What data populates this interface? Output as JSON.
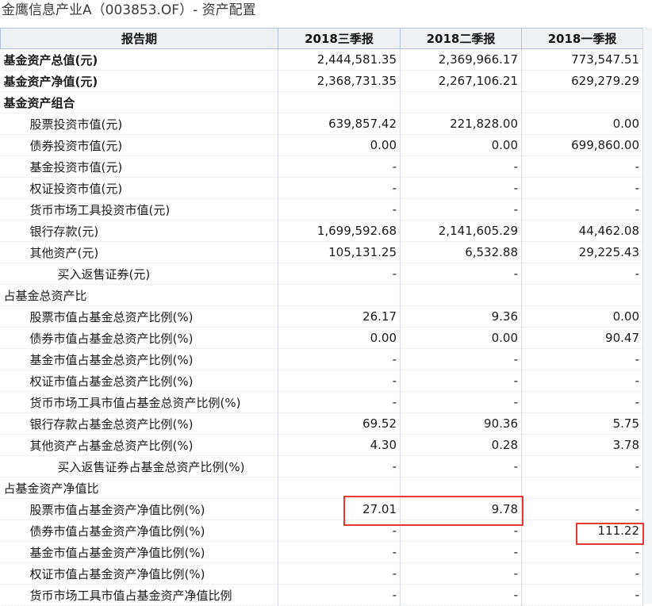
{
  "title": "金鹰信息产业A（003853.OF）- 资产配置",
  "columns": [
    "报告期",
    "2018三季报",
    "2018二季报",
    "2018一季报"
  ],
  "rows": [
    {
      "label": "基金资产总值(元)",
      "level": 0,
      "bold": true,
      "values": [
        "2,444,581.35",
        "2,369,966.17",
        "773,547.51"
      ]
    },
    {
      "label": "基金资产净值(元)",
      "level": 0,
      "bold": true,
      "values": [
        "2,368,731.35",
        "2,267,106.21",
        "629,279.29"
      ]
    },
    {
      "label": "基金资产组合",
      "level": 0,
      "bold": true,
      "values": [
        "",
        "",
        ""
      ]
    },
    {
      "label": "股票投资市值(元)",
      "level": 1,
      "bold": false,
      "values": [
        "639,857.42",
        "221,828.00",
        "0.00"
      ]
    },
    {
      "label": "债券投资市值(元)",
      "level": 1,
      "bold": false,
      "values": [
        "0.00",
        "0.00",
        "699,860.00"
      ]
    },
    {
      "label": "基金投资市值(元)",
      "level": 1,
      "bold": false,
      "values": [
        "-",
        "-",
        "-"
      ]
    },
    {
      "label": "权证投资市值(元)",
      "level": 1,
      "bold": false,
      "values": [
        "-",
        "-",
        "-"
      ]
    },
    {
      "label": "货币市场工具投资市值(元)",
      "level": 1,
      "bold": false,
      "values": [
        "-",
        "-",
        "-"
      ]
    },
    {
      "label": "银行存款(元)",
      "level": 1,
      "bold": false,
      "values": [
        "1,699,592.68",
        "2,141,605.29",
        "44,462.08"
      ]
    },
    {
      "label": "其他资产(元)",
      "level": 1,
      "bold": false,
      "values": [
        "105,131.25",
        "6,532.88",
        "29,225.43"
      ]
    },
    {
      "label": "买入返售证券(元)",
      "level": 2,
      "bold": false,
      "values": [
        "-",
        "-",
        "-"
      ]
    },
    {
      "label": "占基金总资产比",
      "level": 0,
      "bold": false,
      "values": [
        "",
        "",
        ""
      ]
    },
    {
      "label": "股票市值占基金总资产比例(%)",
      "level": 1,
      "bold": false,
      "values": [
        "26.17",
        "9.36",
        "0.00"
      ]
    },
    {
      "label": "债券市值占基金总资产比例(%)",
      "level": 1,
      "bold": false,
      "values": [
        "0.00",
        "0.00",
        "90.47"
      ]
    },
    {
      "label": "基金市值占基金总资产比例(%)",
      "level": 1,
      "bold": false,
      "values": [
        "-",
        "-",
        "-"
      ]
    },
    {
      "label": "权证市值占基金总资产比例(%)",
      "level": 1,
      "bold": false,
      "values": [
        "-",
        "-",
        "-"
      ]
    },
    {
      "label": "货币市场工具市值占基金总资产比例(%)",
      "level": 1,
      "bold": false,
      "values": [
        "-",
        "-",
        "-"
      ]
    },
    {
      "label": "银行存款占基金总资产比例(%)",
      "level": 1,
      "bold": false,
      "values": [
        "69.52",
        "90.36",
        "5.75"
      ]
    },
    {
      "label": "其他资产占基金总资产比例(%)",
      "level": 1,
      "bold": false,
      "values": [
        "4.30",
        "0.28",
        "3.78"
      ]
    },
    {
      "label": "买入返售证券占基金总资产比例(%)",
      "level": 2,
      "bold": false,
      "values": [
        "-",
        "-",
        "-"
      ]
    },
    {
      "label": "占基金资产净值比",
      "level": 0,
      "bold": false,
      "values": [
        "",
        "",
        ""
      ]
    },
    {
      "label": "股票市值占基金资产净值比例(%)",
      "level": 1,
      "bold": false,
      "values": [
        "27.01",
        "9.78",
        "-"
      ]
    },
    {
      "label": "债券市值占基金资产净值比例(%)",
      "level": 1,
      "bold": false,
      "values": [
        "-",
        "-",
        "111.22"
      ]
    },
    {
      "label": "基金市值占基金资产净值比例(%)",
      "level": 1,
      "bold": false,
      "values": [
        "-",
        "-",
        "-"
      ]
    },
    {
      "label": "权证市值占基金资产净值比例(%)",
      "level": 1,
      "bold": false,
      "values": [
        "-",
        "-",
        "-"
      ]
    },
    {
      "label": "货币市场工具市值占基金资产净值比例",
      "level": 1,
      "bold": false,
      "values": [
        "-",
        "-",
        "-"
      ]
    }
  ],
  "colors": {
    "header_bg": "#eef0f4",
    "highlight": "#e53935"
  }
}
